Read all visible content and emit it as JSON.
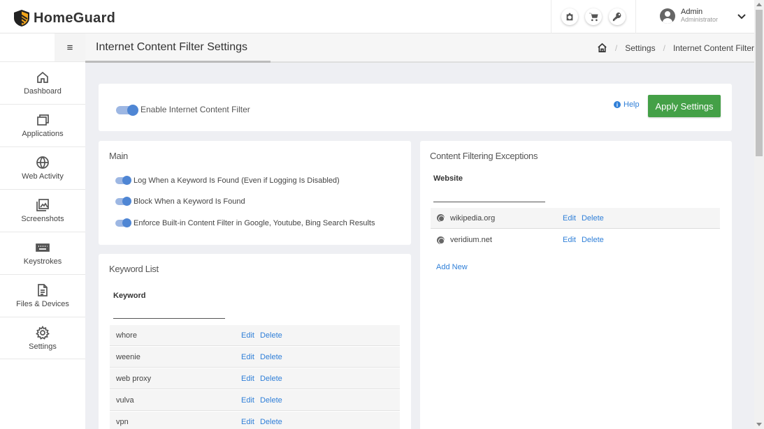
{
  "app": {
    "name": "HomeGuard"
  },
  "header": {
    "tools": [
      "camera-icon",
      "cart-icon",
      "key-icon"
    ],
    "user": {
      "name": "Admin",
      "role": "Administrator"
    }
  },
  "sidebar": {
    "toggle_glyph": "≡",
    "items": [
      {
        "label": "Dashboard",
        "icon": "home-icon"
      },
      {
        "label": "Applications",
        "icon": "windows-icon"
      },
      {
        "label": "Web Activity",
        "icon": "globe-icon"
      },
      {
        "label": "Screenshots",
        "icon": "image-icon"
      },
      {
        "label": "Keystrokes",
        "icon": "keyboard-icon"
      },
      {
        "label": "Files & Devices",
        "icon": "file-icon"
      },
      {
        "label": "Settings",
        "icon": "gear-icon"
      }
    ]
  },
  "page": {
    "title": "Internet Content Filter Settings",
    "breadcrumb": [
      "Settings",
      "Internet Content Filter"
    ]
  },
  "enable_card": {
    "toggle_label": "Enable Internet Content Filter",
    "toggle_on": true,
    "help_label": "Help",
    "apply_label": "Apply Settings"
  },
  "main_card": {
    "title": "Main",
    "options": [
      {
        "label": "Log When a Keyword Is Found (Even if Logging Is Disabled)",
        "on": true
      },
      {
        "label": "Block When a Keyword Is Found",
        "on": true
      },
      {
        "label": "Enforce Built-in Content Filter in Google, Youtube, Bing Search Results",
        "on": true
      }
    ]
  },
  "keyword_card": {
    "title": "Keyword List",
    "column": "Keyword",
    "edit_label": "Edit",
    "delete_label": "Delete",
    "rows": [
      "whore",
      "weenie",
      "web proxy",
      "vulva",
      "vpn"
    ]
  },
  "exceptions_card": {
    "title": "Content Filtering Exceptions",
    "column": "Website",
    "edit_label": "Edit",
    "delete_label": "Delete",
    "rows": [
      "wikipedia.org",
      "veridium.net"
    ],
    "add_label": "Add New"
  },
  "colors": {
    "accent": "#2f7fd8",
    "apply_button": "#44a047",
    "toggle_on": "#4f86d4"
  }
}
